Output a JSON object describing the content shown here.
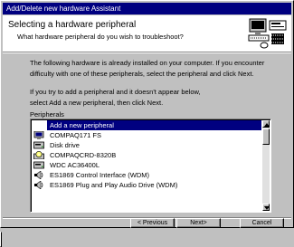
{
  "window": {
    "title": "Add/Delete new hardware Assistant"
  },
  "header": {
    "title": "Selecting a hardware peripheral",
    "subtitle": "What hardware peripheral do you wish to troubleshoot?"
  },
  "body": {
    "para1_line1": "The following hardware is already installed on your computer. If you encounter",
    "para1_line2": "difficulty with one of these peripherals, select the peripheral and click Next.",
    "para2_line1": "If you try to add a peripheral and it doesn't appear below,",
    "para2_line2": "select Add a new peripheral, then click Next."
  },
  "peripherals": {
    "label": "Peripherals",
    "items": [
      {
        "label": "Add a new peripheral",
        "icon": "none",
        "selected": true
      },
      {
        "label": "COMPAQ171 FS",
        "icon": "monitor-icon",
        "selected": false
      },
      {
        "label": "Disk drive",
        "icon": "disk-drive-icon",
        "selected": false
      },
      {
        "label": "COMPAQCRD-8320B",
        "icon": "cdrom-icon",
        "selected": false
      },
      {
        "label": "WDC AC36400L",
        "icon": "disk-drive-icon",
        "selected": false
      },
      {
        "label": "ES1869 Control Interface (WDM)",
        "icon": "speaker-icon",
        "selected": false
      },
      {
        "label": "ES1869 Plug and Play Audio Drive (WDM)",
        "icon": "speaker-icon",
        "selected": false
      }
    ]
  },
  "buttons": {
    "previous": "< Previous",
    "next": "Next>",
    "cancel": "Cancel"
  },
  "colors": {
    "titlebar": "#000080",
    "face": "#c0c0c0",
    "selection": "#000080"
  }
}
